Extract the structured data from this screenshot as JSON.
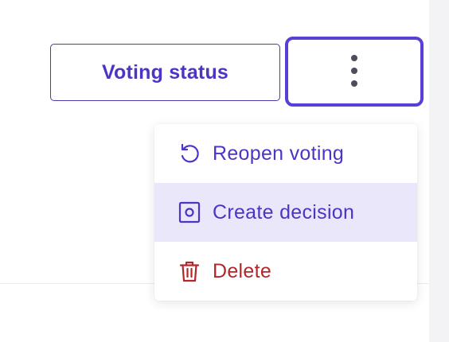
{
  "toolbar": {
    "voting_status_label": "Voting status",
    "more_button_icon": "vertical-ellipsis-icon"
  },
  "menu": {
    "items": [
      {
        "label": "Reopen voting",
        "icon": "reopen-icon",
        "color": "#4c34c4"
      },
      {
        "label": "Create decision",
        "icon": "create-decision-icon",
        "color": "#4c34c4",
        "highlighted": true
      },
      {
        "label": "Delete",
        "icon": "trash-icon",
        "color": "#b3262a"
      }
    ]
  },
  "colors": {
    "accent": "#5b3ed6",
    "highlight_bg": "#ebe7fb",
    "danger": "#b3262a"
  }
}
